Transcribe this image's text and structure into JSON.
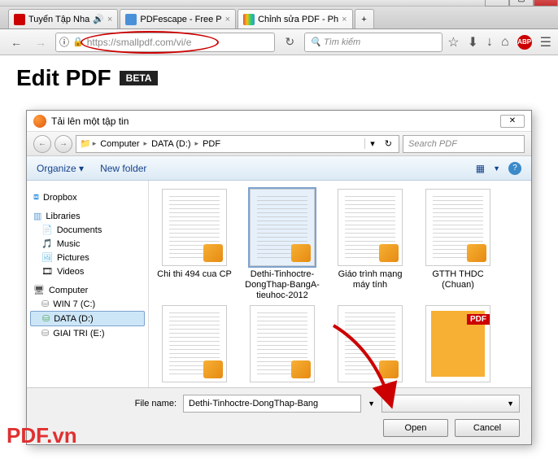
{
  "window": {
    "min": "—",
    "max": "▢",
    "close": "✕"
  },
  "tabs": [
    {
      "label": "Tuyển Tập Nha",
      "fav_bg": "#c00",
      "has_audio": true
    },
    {
      "label": "PDFescape - Free P",
      "fav_bg": "#4a90d9"
    },
    {
      "label": "Chỉnh sửa PDF - Ph",
      "fav_bg": "linear-gradient(90deg,#e74c3c,#f1c40f,#2ecc71,#3498db)"
    }
  ],
  "new_tab": "+",
  "url": {
    "info": "ⓘ",
    "secure": true,
    "text": "https://smallpdf.com/vi/e"
  },
  "search": {
    "placeholder": "Tìm kiếm",
    "icon": "🔍"
  },
  "toolbar": {
    "refresh": "↻",
    "star": "☆",
    "pocket": "⬇",
    "download": "↓",
    "home": "⌂",
    "abp": "ABP",
    "menu": "☰"
  },
  "page": {
    "title": "Edit PDF",
    "badge": "BETA"
  },
  "dialog": {
    "title": "Tải lên một tập tin",
    "close": "✕",
    "nav_back": "←",
    "nav_fwd": "→",
    "breadcrumb": [
      "Computer",
      "DATA (D:)",
      "PDF"
    ],
    "refresh": "↻",
    "search_placeholder": "Search PDF",
    "organize": "Organize ▾",
    "new_folder": "New folder",
    "view_icon": "▦",
    "help_icon": "?",
    "tree": {
      "dropbox": "Dropbox",
      "libraries": "Libraries",
      "lib_items": [
        "Documents",
        "Music",
        "Pictures",
        "Videos"
      ],
      "computer": "Computer",
      "drives": [
        "WIN 7 (C:)",
        "DATA (D:)",
        "GIAI TRI (E:)"
      ]
    },
    "files": [
      {
        "label": "Chi thi 494 cua CP"
      },
      {
        "label": "Dethi-Tinhoctre-DongThap-BangA-tieuhoc-2012",
        "selected": true
      },
      {
        "label": "Giáo trình mạng máy tính"
      },
      {
        "label": "GTTH THDC (Chuan)"
      },
      {
        "label": ""
      },
      {
        "label": ""
      },
      {
        "label": ""
      },
      {
        "label": "",
        "pdf": true
      }
    ],
    "filename_label": "File name:",
    "filename_value": "Dethi-Tinhoctre-DongThap-Bang",
    "filetype": "*.",
    "open": "Open",
    "cancel": "Cancel"
  },
  "watermark": "PDF.vn"
}
